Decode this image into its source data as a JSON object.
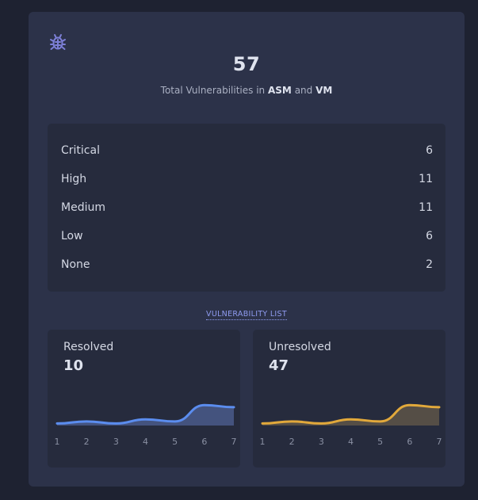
{
  "summary": {
    "total": "57",
    "subtitle_prefix": "Total Vulnerabilities in",
    "subtitle_a": "ASM",
    "subtitle_and": "and",
    "subtitle_b": "VM"
  },
  "severities": [
    {
      "label": "Critical",
      "count": "6"
    },
    {
      "label": "High",
      "count": "11"
    },
    {
      "label": "Medium",
      "count": "11"
    },
    {
      "label": "Low",
      "count": "6"
    },
    {
      "label": "None",
      "count": "2"
    }
  ],
  "vulnerability_list_link": "VULNERABILITY LIST",
  "resolved": {
    "label": "Resolved",
    "value": "10"
  },
  "unresolved": {
    "label": "Unresolved",
    "value": "47"
  },
  "colors": {
    "resolved_line": "#5b8def",
    "unresolved_line": "#e2a93b",
    "icon": "#7c7fd6"
  },
  "icons": {
    "header": "bug-icon"
  },
  "chart_data": [
    {
      "type": "area",
      "x": [
        1,
        2,
        3,
        4,
        5,
        6,
        7
      ],
      "series": [
        {
          "name": "Resolved",
          "values": [
            1,
            2,
            1,
            3,
            2,
            10,
            9
          ]
        }
      ],
      "ylim": [
        0,
        14
      ],
      "grid": false
    },
    {
      "type": "area",
      "x": [
        1,
        2,
        3,
        4,
        5,
        6,
        7
      ],
      "series": [
        {
          "name": "Unresolved",
          "values": [
            1,
            2,
            1,
            3,
            2,
            10,
            9
          ]
        }
      ],
      "ylim": [
        0,
        14
      ],
      "grid": false
    }
  ]
}
